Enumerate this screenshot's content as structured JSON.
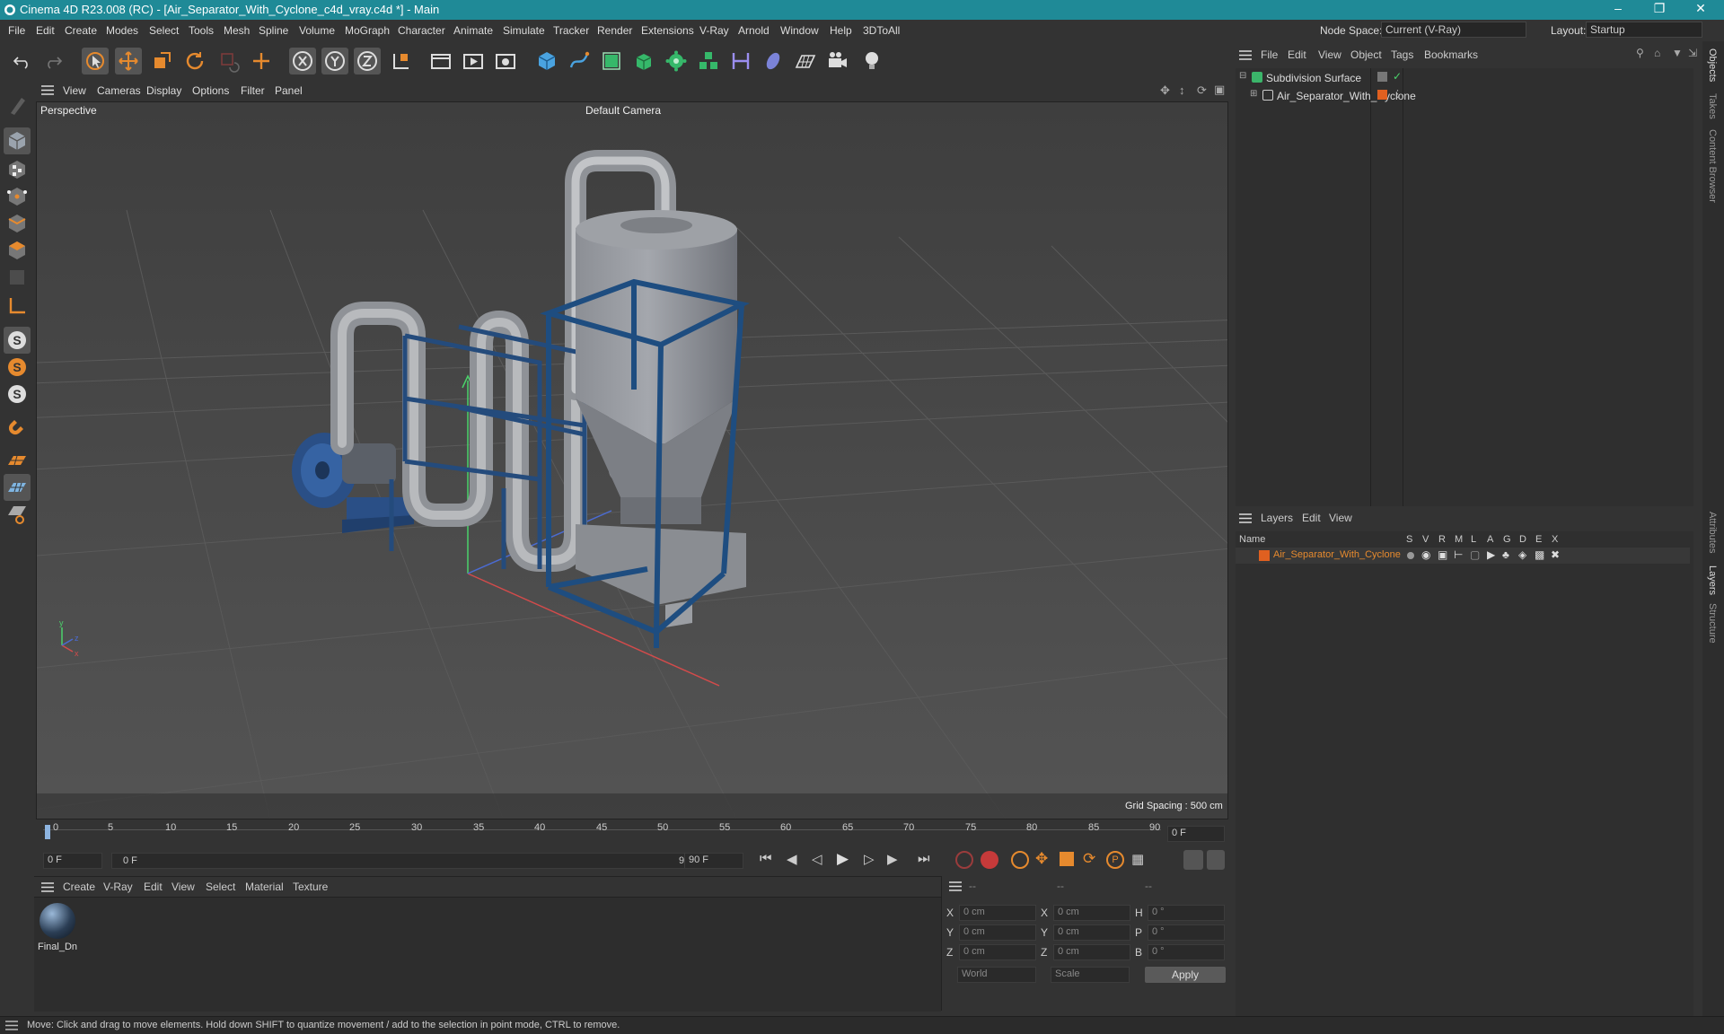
{
  "title_bar": {
    "title": "Cinema 4D R23.008 (RC) - [Air_Separator_With_Cyclone_c4d_vray.c4d *] - Main"
  },
  "menubar": {
    "items": [
      "File",
      "Edit",
      "Create",
      "Modes",
      "Select",
      "Tools",
      "Mesh",
      "Spline",
      "Volume",
      "MoGraph",
      "Character",
      "Animate",
      "Simulate",
      "Tracker",
      "Render",
      "Extensions",
      "V-Ray",
      "Arnold",
      "Window",
      "Help",
      "3DToAll"
    ],
    "node_space_label": "Node Space:",
    "node_space_value": "Current (V-Ray)",
    "layout_label": "Layout:",
    "layout_value": "Startup"
  },
  "viewport_menu": {
    "items": [
      "View",
      "Cameras",
      "Display",
      "Options",
      "Filter",
      "Panel"
    ]
  },
  "viewport": {
    "view_name": "Perspective",
    "camera": "Default Camera",
    "grid_spacing": "Grid Spacing : 500 cm"
  },
  "timeline": {
    "ticks": [
      "0",
      "5",
      "10",
      "15",
      "20",
      "25",
      "30",
      "35",
      "40",
      "45",
      "50",
      "55",
      "60",
      "65",
      "70",
      "75",
      "80",
      "85",
      "90"
    ],
    "current_frame": "0 F"
  },
  "transport": {
    "start_frame": "0 F",
    "range_start": "0 F",
    "range_end": "90 F",
    "end_frame": "90 F"
  },
  "materials_menu": {
    "items": [
      "Create",
      "V-Ray",
      "Edit",
      "View",
      "Select",
      "Material",
      "Texture"
    ]
  },
  "materials": [
    {
      "name": "Final_Dn"
    }
  ],
  "coordinates": {
    "headers": [
      "--",
      "--",
      "--"
    ],
    "rows": [
      {
        "a": "X",
        "av": "0 cm",
        "b": "X",
        "bv": "0 cm",
        "c": "H",
        "cv": "0 °"
      },
      {
        "a": "Y",
        "av": "0 cm",
        "b": "Y",
        "bv": "0 cm",
        "c": "P",
        "cv": "0 °"
      },
      {
        "a": "Z",
        "av": "0 cm",
        "b": "Z",
        "bv": "0 cm",
        "c": "B",
        "cv": "0 °"
      }
    ],
    "mode_world": "World",
    "mode_scale": "Scale",
    "apply_label": "Apply"
  },
  "objects_menu": {
    "items": [
      "File",
      "Edit",
      "View",
      "Object",
      "Tags",
      "Bookmarks"
    ]
  },
  "objects": [
    {
      "name": "Subdivision Surface"
    },
    {
      "name": "Air_Separator_With_Cyclone"
    }
  ],
  "layers_menu": {
    "items": [
      "Layers",
      "Edit",
      "View"
    ]
  },
  "layers_table": {
    "name_header": "Name",
    "columns": [
      "S",
      "V",
      "R",
      "M",
      "L",
      "A",
      "G",
      "D",
      "E",
      "X"
    ],
    "rows": [
      {
        "name": "Air_Separator_With_Cyclone",
        "color": "#e06020"
      }
    ]
  },
  "side_tabs": [
    "Objects",
    "Takes",
    "Content Browser",
    "Attributes",
    "Layers",
    "Structure"
  ],
  "status": {
    "text": "Move: Click and drag to move elements. Hold down SHIFT to quantize movement / add to the selection in point mode, CTRL to remove."
  },
  "colors": {
    "accent": "#e68a2e",
    "title_bar": "#1f8a97",
    "frame_blue": "#1e4d80",
    "layer_orange": "#e06020"
  }
}
